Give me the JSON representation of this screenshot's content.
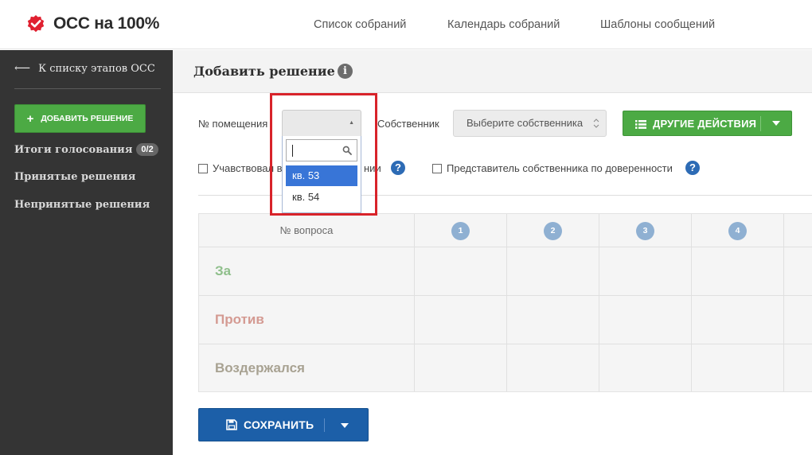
{
  "brand": {
    "name": "ОСС на 100%",
    "logo_icon": "check-badge-icon",
    "logo_color": "#e02030"
  },
  "topnav": [
    {
      "label": "Список собраний"
    },
    {
      "label": "Календарь собраний"
    },
    {
      "label": "Шаблоны сообщений"
    }
  ],
  "sidebar": {
    "back_label": "К списку этапов ОСС",
    "add_button": "ДОБАВИТЬ РЕШЕНИЕ",
    "items": [
      {
        "label": "Итоги голосования",
        "badge": "0/2"
      },
      {
        "label": "Принятые решения"
      },
      {
        "label": "Непринятые решения"
      }
    ]
  },
  "page": {
    "title": "Добавить решение"
  },
  "form": {
    "room_label": "№ помещения",
    "room_value": "",
    "room_search_value": "",
    "room_options": [
      "кв. 53",
      "кв. 54"
    ],
    "room_highlighted_option": "кв. 53",
    "owner_label": "Собственник",
    "owner_placeholder": "Выберите собственника",
    "actions_button": "ДРУГИЕ ДЕЙСТВИЯ",
    "participated_label_visible": "Учавствовал в",
    "participated_label_tail": "нии",
    "participated_checked": false,
    "representative_label": "Представитель собственника по доверенности",
    "representative_checked": false
  },
  "votes_table": {
    "header": "№ вопроса",
    "questions": [
      "1",
      "2",
      "3",
      "4"
    ],
    "rows": [
      {
        "label": "За",
        "color": "#8fbf8b"
      },
      {
        "label": "Против",
        "color": "#d49a92"
      },
      {
        "label": "Воздержался",
        "color": "#a8a292"
      }
    ]
  },
  "save_button": "СОХРАНИТЬ",
  "colors": {
    "primary_green": "#4caa44",
    "primary_blue": "#1c5fa8",
    "sidebar_bg": "#343434",
    "highlight_red": "#d8232a"
  }
}
